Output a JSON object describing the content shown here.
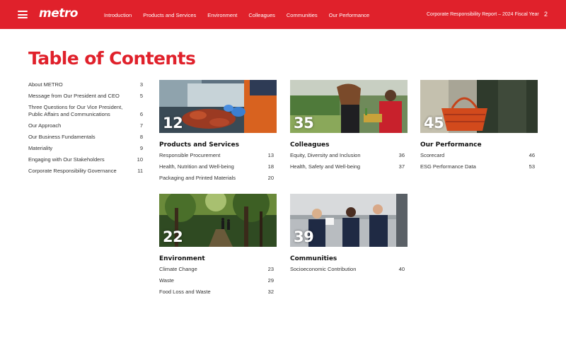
{
  "header": {
    "logo": "metro",
    "nav": [
      "Introduction",
      "Products and Services",
      "Environment",
      "Colleagues",
      "Communities",
      "Our Performance"
    ],
    "report_title": "Corporate Responsibility Report – 2024 Fiscal Year",
    "page_number": "2"
  },
  "heading": "Table of Contents",
  "toc": [
    {
      "label": "About METRO",
      "page": "3"
    },
    {
      "label": "Message from Our President and CEO",
      "page": "5"
    },
    {
      "label": "Three Questions for Our Vice President, Public Affairs and Communications",
      "page": "6"
    },
    {
      "label": "Our Approach",
      "page": "7"
    },
    {
      "label": "Our Business Fundamentals",
      "page": "8"
    },
    {
      "label": "Materiality",
      "page": "9"
    },
    {
      "label": "Engaging with Our Stakeholders",
      "page": "10"
    },
    {
      "label": "Corporate Responsibility Governance",
      "page": "11"
    }
  ],
  "sections": [
    {
      "number": "12",
      "title": "Products and Services",
      "items": [
        {
          "label": "Responsible Procurement",
          "page": "13"
        },
        {
          "label": "Health, Nutrition and Well-being",
          "page": "18"
        },
        {
          "label": "Packaging and Printed Materials",
          "page": "20"
        }
      ]
    },
    {
      "number": "35",
      "title": "Colleagues",
      "items": [
        {
          "label": "Equity, Diversity and Inclusion",
          "page": "36"
        },
        {
          "label": "Health, Safety and Well-being",
          "page": "37"
        }
      ]
    },
    {
      "number": "45",
      "title": "Our Performance",
      "items": [
        {
          "label": "Scorecard",
          "page": "46"
        },
        {
          "label": "ESG Performance Data",
          "page": "53"
        }
      ]
    },
    {
      "number": "22",
      "title": "Environment",
      "items": [
        {
          "label": "Climate Change",
          "page": "23"
        },
        {
          "label": "Waste",
          "page": "29"
        },
        {
          "label": "Food Loss and Waste",
          "page": "32"
        }
      ]
    },
    {
      "number": "39",
      "title": "Communities",
      "items": [
        {
          "label": "Socioeconomic Contribution",
          "page": "40"
        }
      ]
    }
  ],
  "colors": {
    "brand_red": "#e0212b"
  }
}
